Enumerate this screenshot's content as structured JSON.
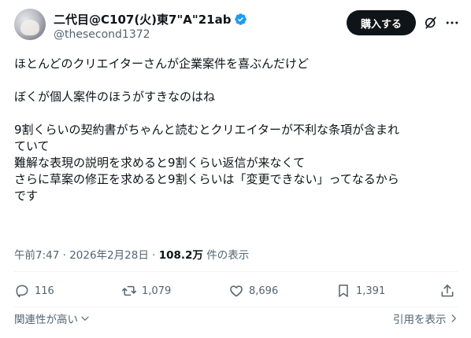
{
  "author": {
    "display_name": "二代目@C107(火)東7\"A\"21ab",
    "handle": "@thesecond1372"
  },
  "header": {
    "buy_label": "購入する"
  },
  "tweet": {
    "lines": [
      "ほとんどのクリエイターさんが企業案件を喜ぶんだけど",
      "",
      "ぼくが個人案件のほうがすきなのはね",
      "",
      "9割くらいの契約書がちゃんと読むとクリエイターが不利な条項が含まれ",
      "ていて",
      "難解な表現の説明を求めると9割くらい返信が来なくて",
      "さらに草案の修正を求めると9割くらいは「変更できない」ってなるから",
      "です"
    ],
    "time": "午前7:47",
    "separator": " · ",
    "date": "2026年2月28日",
    "views": "108.2万",
    "views_suffix": " 件の表示"
  },
  "actions": {
    "replies": "116",
    "reposts": "1,079",
    "likes": "8,696",
    "bookmarks": "1,391"
  },
  "footer": {
    "sort_label": "関連性が高い",
    "quotes_label": "引用を表示"
  },
  "colors": {
    "verified": "#1d9bf0",
    "text": "#0f1419",
    "muted": "#536471"
  }
}
